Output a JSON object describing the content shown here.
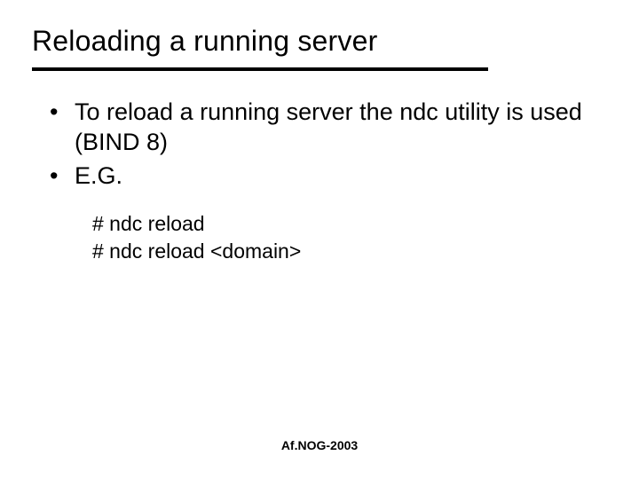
{
  "title": "Reloading a running server",
  "bullets": {
    "b0": "To reload a running server the ndc utility is used (BIND 8)",
    "b1": "E.G."
  },
  "code": {
    "line0": "# ndc reload",
    "line1": "# ndc reload <domain>"
  },
  "footer": "Af.NOG-2003"
}
